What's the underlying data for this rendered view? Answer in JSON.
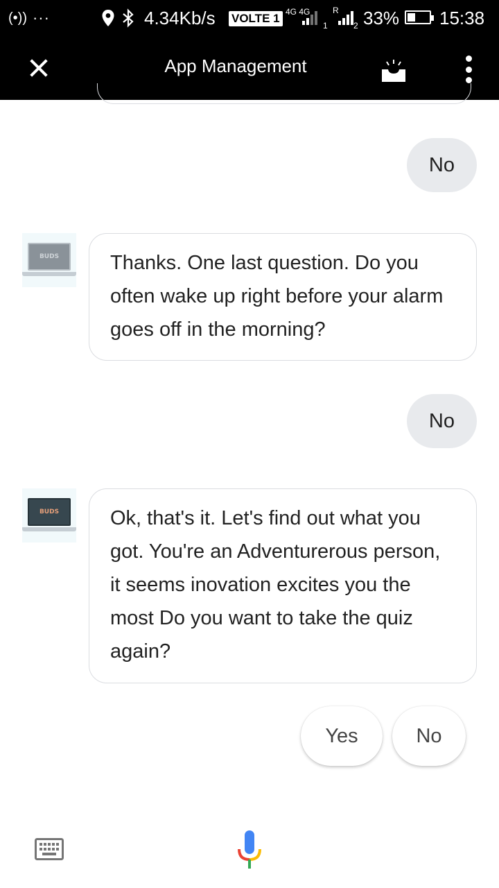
{
  "status_bar": {
    "hotspot": "(•))",
    "dots": "···",
    "speed": "4.34Kb/s",
    "volte": "VOLTE 1",
    "network": "4G 4G",
    "sim1": "1",
    "roaming": "R",
    "sim2": "2",
    "battery": "33%",
    "battery_level": 0.33,
    "time": "15:38"
  },
  "app_bar": {
    "title": "App Management",
    "close_icon": "close-icon",
    "tray_icon": "inbox-tray-icon",
    "menu_icon": "more-vert-icon"
  },
  "conversation": {
    "messages": [
      {
        "from": "user",
        "text": "No"
      },
      {
        "from": "bot",
        "avatar_label": "BUDS",
        "text": "Thanks. One last question. Do you often wake up right before your alarm goes off in the morning?"
      },
      {
        "from": "user",
        "text": "No"
      },
      {
        "from": "bot",
        "avatar_label": "BUDS",
        "text": "Ok, that's it. Let's find out what you got. You're an Adventurerous person, it seems inovation excites you the most Do you want to take the quiz again?"
      }
    ],
    "suggestions": [
      "Yes",
      "No"
    ]
  },
  "bottom_bar": {
    "keyboard_icon": "keyboard-icon",
    "mic_icon": "google-mic-icon",
    "mic_colors": {
      "blue": "#4285f4",
      "red": "#ea4335",
      "yellow": "#fbbc05",
      "green": "#34a853"
    }
  }
}
